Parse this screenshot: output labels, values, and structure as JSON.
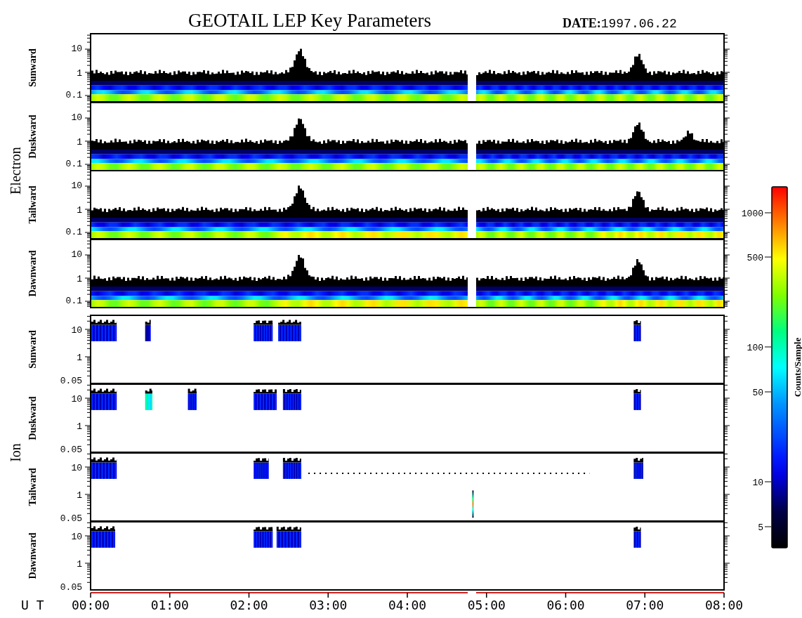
{
  "title": "GEOTAIL LEP Key Parameters",
  "date": {
    "label": "DATE:",
    "value": "1997.06.22"
  },
  "groups": [
    {
      "name": "Electron",
      "panels": [
        {
          "label": "Sunward",
          "yticks": [
            "10",
            "1",
            "0.1"
          ]
        },
        {
          "label": "Duskward",
          "yticks": [
            "10",
            "1",
            "0.1"
          ]
        },
        {
          "label": "Tailward",
          "yticks": [
            "10",
            "1",
            "0.1"
          ]
        },
        {
          "label": "Dawnward",
          "yticks": [
            "10",
            "1",
            "0.1"
          ]
        }
      ]
    },
    {
      "name": "Ion",
      "panels": [
        {
          "label": "Sunward",
          "yticks": [
            "10",
            "1",
            "0.05"
          ]
        },
        {
          "label": "Duskward",
          "yticks": [
            "10",
            "1",
            "0.05"
          ]
        },
        {
          "label": "Tailward",
          "yticks": [
            "10",
            "1",
            "0.05"
          ]
        },
        {
          "label": "Dawnward",
          "yticks": [
            "10",
            "1",
            "0.05"
          ]
        }
      ]
    }
  ],
  "time_axis": {
    "label": "U T",
    "ticks": [
      "00:00",
      "01:00",
      "02:00",
      "03:00",
      "04:00",
      "05:00",
      "06:00",
      "07:00",
      "08:00"
    ]
  },
  "colorbar": {
    "label": "Counts/Sample",
    "ticks": [
      "1000",
      "500",
      "100",
      "50",
      "10",
      "5"
    ]
  }
}
